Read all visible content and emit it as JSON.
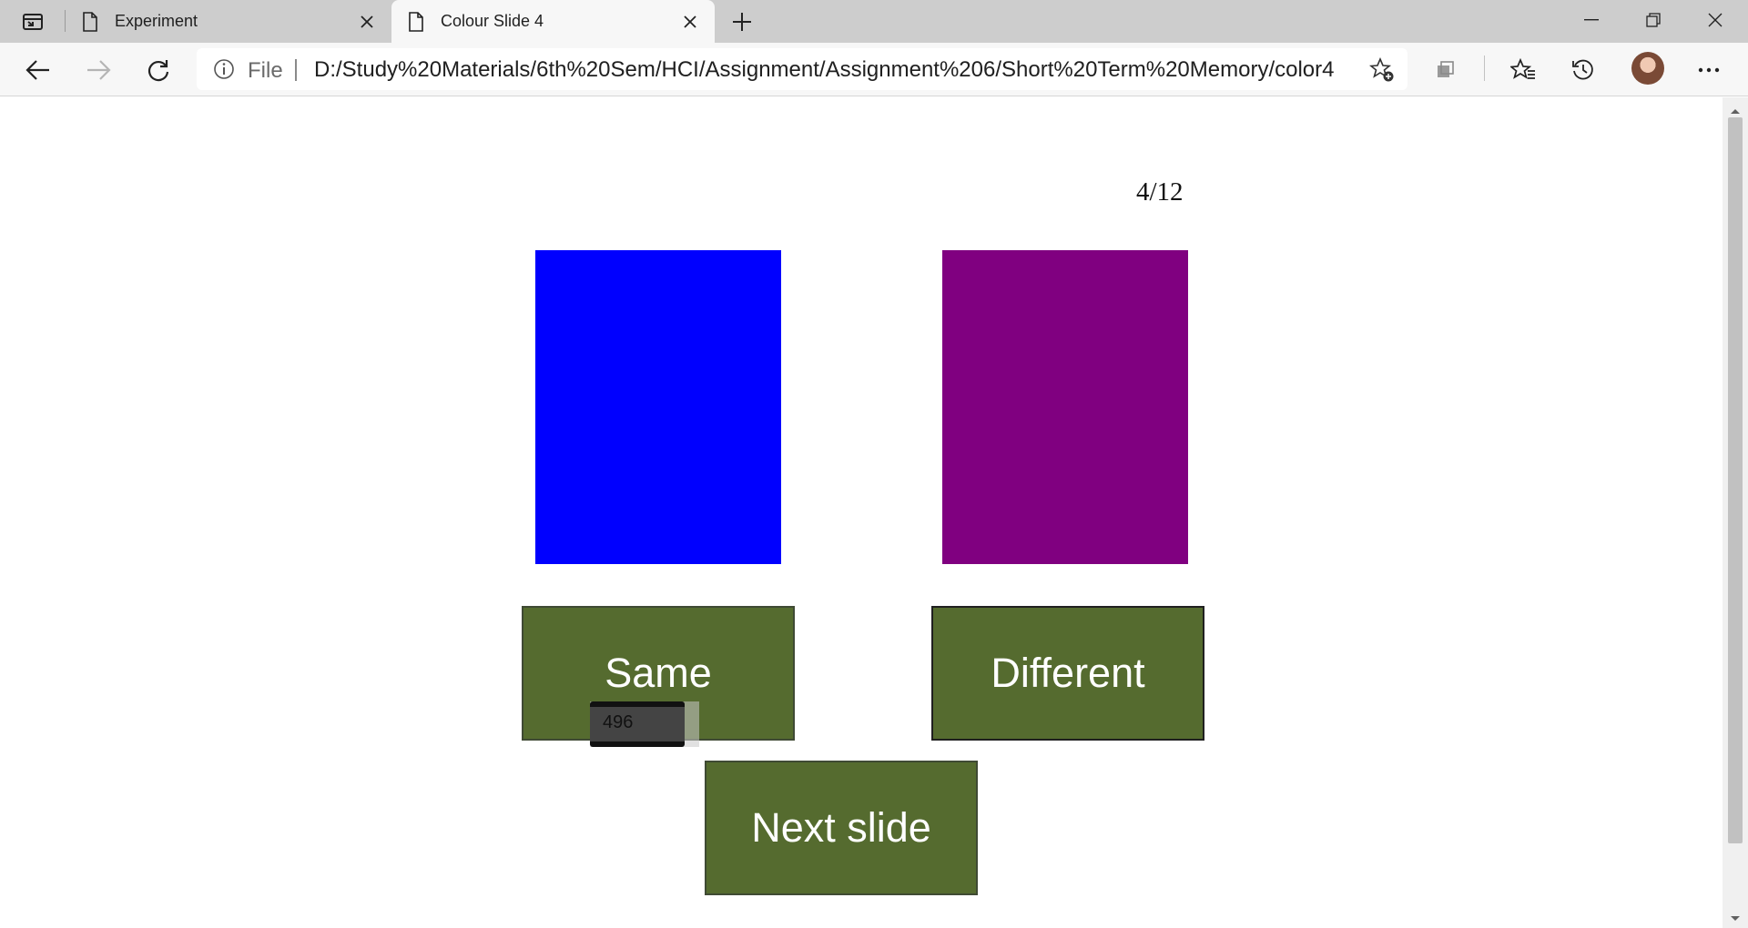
{
  "browser": {
    "tabs": [
      {
        "title": "Experiment",
        "active": false
      },
      {
        "title": "Colour Slide 4",
        "active": true
      }
    ],
    "address": {
      "scheme_label": "File",
      "url": "D:/Study%20Materials/6th%20Sem/HCI/Assignment/Assignment%206/Short%20Term%20Memory/color4..."
    },
    "icons": {
      "tab_actions": "tab-actions-icon",
      "page": "page-icon",
      "close": "close-icon",
      "new_tab": "plus-icon",
      "back": "back-arrow-icon",
      "forward": "forward-arrow-icon",
      "refresh": "refresh-icon",
      "info": "info-icon",
      "add_favorite": "add-favorite-star-icon",
      "collections": "collections-icon",
      "favorites": "favorites-icon",
      "history": "history-icon",
      "more": "more-icon",
      "minimize": "minimize-icon",
      "restore": "restore-icon",
      "close_window": "close-window-icon"
    }
  },
  "page": {
    "counter": "4/12",
    "swatch_left_color": "#0000ff",
    "swatch_right_color": "#800080",
    "buttons": {
      "same": "Same",
      "different": "Different",
      "next": "Next slide"
    },
    "button_color": "#556b2f",
    "tooltip": "496"
  }
}
